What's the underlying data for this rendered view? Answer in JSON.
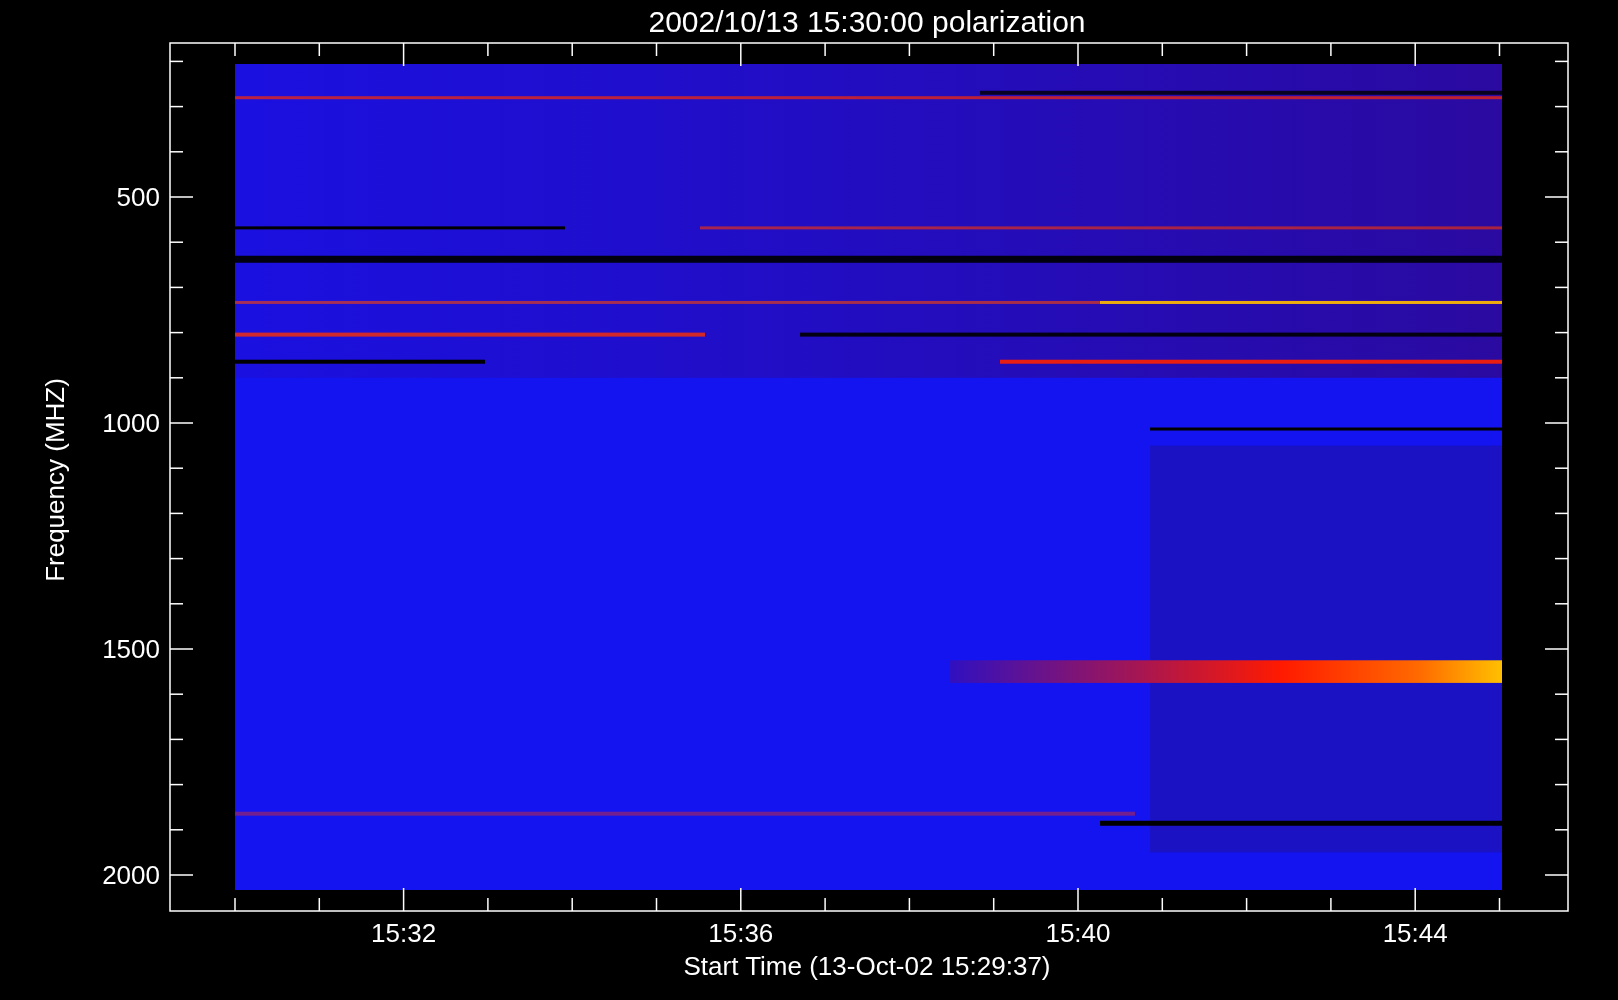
{
  "title": "2002/10/13 15:30:00 polarization",
  "axes": {
    "xlabel": "Start Time (13-Oct-02 15:29:37)",
    "ylabel": "Frequency (MHZ)",
    "xticks": [
      "15:32",
      "15:36",
      "15:40",
      "15:44"
    ],
    "yticks": [
      "500",
      "1000",
      "1500",
      "2000"
    ]
  }
}
